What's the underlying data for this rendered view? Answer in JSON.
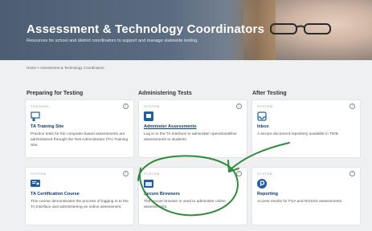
{
  "header": {
    "title": "Assessment & Technology Coordinators",
    "subtitle": "Resources for school and district coordinators to support and manage statewide testing."
  },
  "breadcrumb": "Home > Assessment & Technology Coordinators",
  "columns": [
    {
      "title": "Preparing for Testing"
    },
    {
      "title": "Administering Tests"
    },
    {
      "title": "After Testing"
    }
  ],
  "cards": [
    {
      "tag": "TRAINING",
      "name": "TA Training Site",
      "desc": "Practice tests for the computer-based assessments are administered through the Test Administrator (TA) Training Site.",
      "icon": "person-screen-icon"
    },
    {
      "tag": "SYSTEM",
      "name": "Administer Assessments",
      "desc": "Log in to the TA Interface to administer operational/live assessments to students.",
      "icon": "screen-icon"
    },
    {
      "tag": "SYSTEM",
      "name": "Inbox",
      "desc": "A secure document repository available in TIDE.",
      "icon": "inbox-icon"
    },
    {
      "tag": "SYSTEM",
      "name": "TA Certification Course",
      "desc": "This course demonstrates the process of logging in to the TA Interface and administering an online assessment.",
      "icon": "certificate-icon"
    },
    {
      "tag": "SYSTEM",
      "name": "Secure Browsers",
      "desc": "The secure browser is used to administer online assessments.",
      "icon": "browser-icon"
    },
    {
      "tag": "SYSTEM",
      "name": "Reporting",
      "desc": "Access results for FSA and NGSSS assessments.",
      "icon": "reporting-icon"
    }
  ],
  "colors": {
    "link": "#123a73",
    "icon": "#1f5fa8",
    "annotation": "#2e8b3a"
  }
}
